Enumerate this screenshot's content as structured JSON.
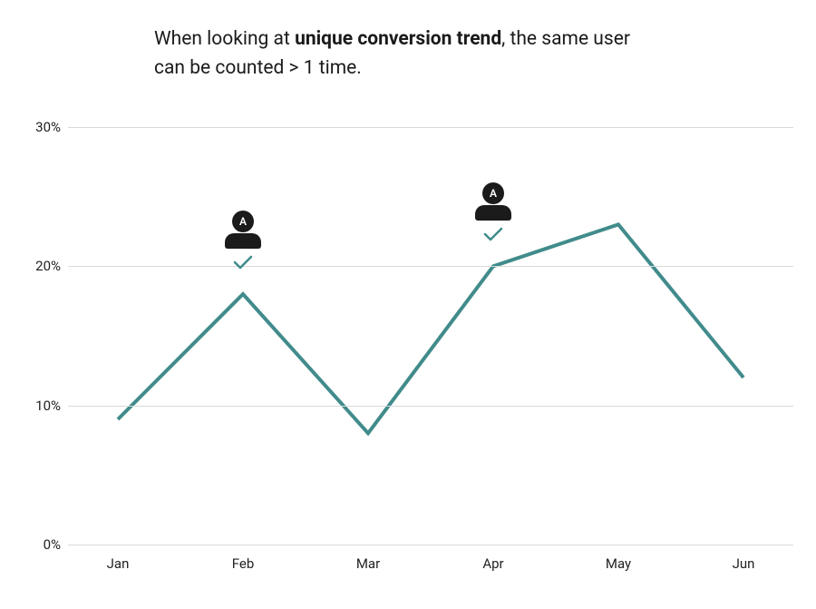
{
  "title": {
    "pre": "When looking at ",
    "bold": "unique conversion trend",
    "post": ", the same user can be counted > 1 time."
  },
  "chart_data": {
    "type": "line",
    "categories": [
      "Jan",
      "Feb",
      "Mar",
      "Apr",
      "May",
      "Jun"
    ],
    "values": [
      9,
      18,
      8,
      20,
      23,
      12
    ],
    "ylabel": "",
    "xlabel": "",
    "ylim": [
      0,
      30
    ],
    "y_ticks": [
      0,
      10,
      20,
      30
    ],
    "y_tick_labels": [
      "0%",
      "10%",
      "20%",
      "30%"
    ],
    "annotations": [
      {
        "category": "Feb",
        "label": "A"
      },
      {
        "category": "Apr",
        "label": "A"
      }
    ]
  },
  "colors": {
    "line": "#418b8c",
    "check": "#418b8c",
    "grid": "#d9d9d9",
    "icon": "#1b1b1b"
  }
}
